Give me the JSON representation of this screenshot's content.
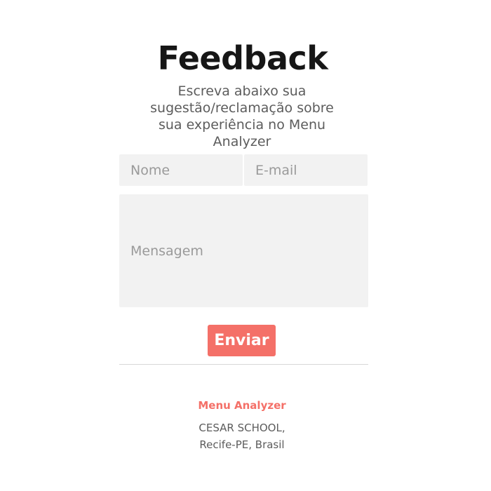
{
  "header": {
    "title": "Feedback",
    "subtitle": "Escreva abaixo sua sugestão/reclamação sobre sua experiência no Menu Analyzer"
  },
  "form": {
    "name_placeholder": "Nome",
    "name_value": "",
    "email_placeholder": "E-mail",
    "email_value": "",
    "message_placeholder": "Mensagem",
    "message_value": "",
    "submit_label": "Enviar"
  },
  "footer": {
    "brand": "Menu Analyzer",
    "address_line1": "CESAR SCHOOL,",
    "address_line2": "Recife-PE, Brasil"
  },
  "colors": {
    "accent": "#f47068",
    "title": "#161616",
    "text": "#5c5c5c",
    "field_bg": "#f2f2f2"
  }
}
